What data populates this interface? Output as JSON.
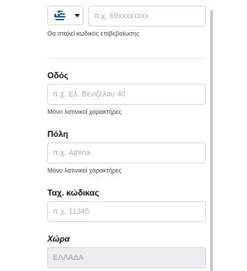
{
  "phone": {
    "country_flag": "greece-flag-icon",
    "placeholder": "π.χ. 69xxxxxxxx",
    "value": "",
    "hint": "Θα σταλεί κωδικός επιβεβαίωσης"
  },
  "street": {
    "label": "Οδός",
    "placeholder": "π.χ. Ελ. Βενιζέλου 40",
    "value": "",
    "hint": "Μόνο λατινικοί χαρακτήρες"
  },
  "city": {
    "label": "Πόλη",
    "placeholder": "π.χ. Athina",
    "value": "",
    "hint": "Μόνο λατινικοί χαρακτήρες"
  },
  "postal_code": {
    "label": "Ταχ. κώδικας",
    "placeholder": "π.χ. 11345",
    "value": ""
  },
  "country": {
    "label": "Χώρα",
    "value": "ΕΛΛΑΔΑ"
  }
}
